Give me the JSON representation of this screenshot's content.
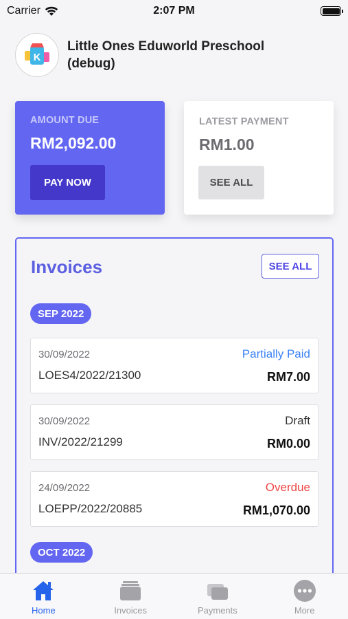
{
  "status_bar": {
    "carrier": "Carrier",
    "time": "2:07 PM"
  },
  "header": {
    "school_name": "Little Ones Eduworld Preschool (debug)",
    "logo_icon": "school-logo-icon"
  },
  "amount_due": {
    "label": "AMOUNT DUE",
    "amount": "RM2,092.00",
    "button": "PAY NOW"
  },
  "latest_payment": {
    "label": "LATEST PAYMENT",
    "amount": "RM1.00",
    "button": "SEE ALL"
  },
  "invoices": {
    "title": "Invoices",
    "see_all": "SEE ALL",
    "groups": [
      {
        "month": "SEP 2022",
        "items": [
          {
            "date": "30/09/2022",
            "status": "Partially Paid",
            "number": "LOES4/2022/21300",
            "amount": "RM7.00"
          },
          {
            "date": "30/09/2022",
            "status": "Draft",
            "number": "INV/2022/21299",
            "amount": "RM0.00"
          },
          {
            "date": "24/09/2022",
            "status": "Overdue",
            "number": "LOEPP/2022/20885",
            "amount": "RM1,070.00"
          }
        ]
      },
      {
        "month": "OCT 2022",
        "items": []
      }
    ]
  },
  "tabs": [
    {
      "label": "Home",
      "icon": "home-icon",
      "active": true
    },
    {
      "label": "Invoices",
      "icon": "invoices-icon",
      "active": false
    },
    {
      "label": "Payments",
      "icon": "payments-icon",
      "active": false
    },
    {
      "label": "More",
      "icon": "more-icon",
      "active": false
    }
  ],
  "colors": {
    "accent": "#6366f1",
    "accent_dark": "#4338ca",
    "partially_paid": "#3b82f6",
    "overdue": "#ef4444",
    "active_tab": "#2563eb"
  }
}
